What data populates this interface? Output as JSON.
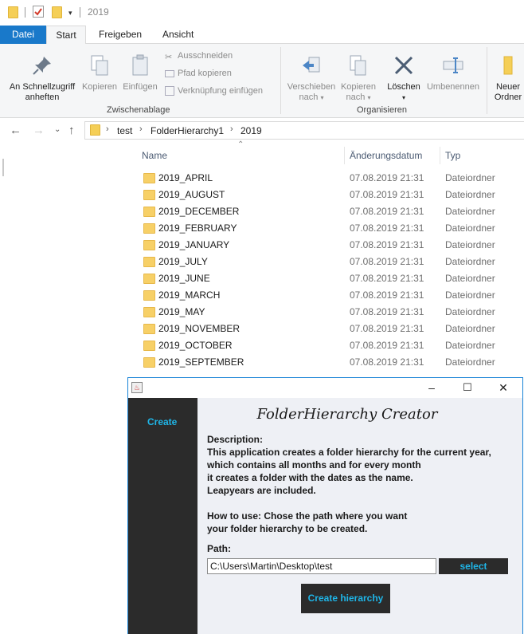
{
  "window": {
    "title": "2019"
  },
  "ribbon": {
    "tabs": [
      "Datei",
      "Start",
      "Freigeben",
      "Ansicht"
    ],
    "clipboard": {
      "pin_line1": "An Schnellzugriff",
      "pin_line2": "anheften",
      "copy": "Kopieren",
      "paste": "Einfügen",
      "cut": "Ausschneiden",
      "copy_path": "Pfad kopieren",
      "paste_shortcut": "Verknüpfung einfügen",
      "group_label": "Zwischenablage"
    },
    "organize": {
      "move_line1": "Verschieben",
      "move_line2": "nach",
      "copy_to_line1": "Kopieren",
      "copy_to_line2": "nach",
      "delete": "Löschen",
      "rename": "Umbenennen",
      "group_label": "Organisieren"
    },
    "new": {
      "line1": "Neuer",
      "line2": "Ordner"
    }
  },
  "address": {
    "crumbs": [
      "test",
      "FolderHierarchy1",
      "2019"
    ]
  },
  "columns": {
    "name": "Name",
    "date": "Änderungsdatum",
    "type": "Typ"
  },
  "files": [
    {
      "name": "2019_APRIL",
      "date": "07.08.2019 21:31",
      "type": "Dateiordner"
    },
    {
      "name": "2019_AUGUST",
      "date": "07.08.2019 21:31",
      "type": "Dateiordner"
    },
    {
      "name": "2019_DECEMBER",
      "date": "07.08.2019 21:31",
      "type": "Dateiordner"
    },
    {
      "name": "2019_FEBRUARY",
      "date": "07.08.2019 21:31",
      "type": "Dateiordner"
    },
    {
      "name": "2019_JANUARY",
      "date": "07.08.2019 21:31",
      "type": "Dateiordner"
    },
    {
      "name": "2019_JULY",
      "date": "07.08.2019 21:31",
      "type": "Dateiordner"
    },
    {
      "name": "2019_JUNE",
      "date": "07.08.2019 21:31",
      "type": "Dateiordner"
    },
    {
      "name": "2019_MARCH",
      "date": "07.08.2019 21:31",
      "type": "Dateiordner"
    },
    {
      "name": "2019_MAY",
      "date": "07.08.2019 21:31",
      "type": "Dateiordner"
    },
    {
      "name": "2019_NOVEMBER",
      "date": "07.08.2019 21:31",
      "type": "Dateiordner"
    },
    {
      "name": "2019_OCTOBER",
      "date": "07.08.2019 21:31",
      "type": "Dateiordner"
    },
    {
      "name": "2019_SEPTEMBER",
      "date": "07.08.2019 21:31",
      "type": "Dateiordner"
    }
  ],
  "app": {
    "sidebar_link": "Create",
    "heading": "FolderHierarchy Creator",
    "description_label": "Description:",
    "description_lines": [
      "This application creates a folder hierarchy for the current year,",
      "which contains all months and for every month",
      "it creates a folder with the dates as the name.",
      "Leapyears are included."
    ],
    "howto_lines": [
      "How to use: Chose the path where you want",
      "your folder hierarchy to be created."
    ],
    "path_label": "Path:",
    "path_value": "C:\\Users\\Martin\\Desktop\\test",
    "select_label": "select",
    "create_label": "Create hierarchy"
  }
}
